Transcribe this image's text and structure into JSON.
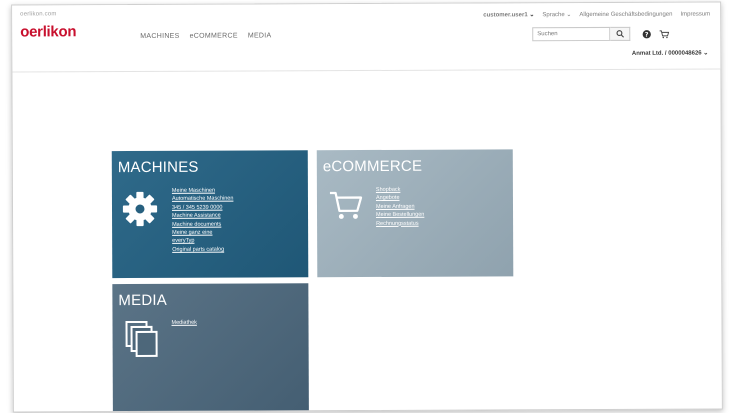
{
  "header": {
    "brand_small": "oerlikon.com",
    "logo": "oerlikon",
    "nav": [
      "MACHINES",
      "eCOMMERCE",
      "MEDIA"
    ],
    "top_links": {
      "user": "customer.user1",
      "language": "Sprache",
      "terms": "Allgemeine Geschäftsbedingungen",
      "imprint": "Impressum"
    },
    "search": {
      "placeholder": "Suchen",
      "value": ""
    },
    "account": "Anmat Ltd. / 0000048626"
  },
  "tiles": {
    "machines": {
      "title": "MACHINES",
      "links": [
        "Meine Maschinen",
        "Automatische Maschinen",
        "345 / 345 5239 0000",
        "Machine Assistance",
        "Machine documents",
        "Meine ganz eine",
        "everyTyp",
        "Original parts catalog"
      ]
    },
    "ecommerce": {
      "title": "eCOMMERCE",
      "links": [
        "Shopback",
        "Angebote",
        "Meine Anfragen",
        "Meine Bestellungen",
        "Rechnungsstatus"
      ]
    },
    "media": {
      "title": "MEDIA",
      "links": [
        "Mediathek"
      ]
    }
  },
  "colors": {
    "brand": "#c8102e",
    "machines_tile": "#2a6585",
    "ecommerce_tile": "#a0b2be",
    "media_tile": "#526b7e"
  },
  "icons": {
    "search": "search-icon",
    "help": "help-icon",
    "cart": "cart-icon",
    "machines": "gear-icon",
    "ecommerce": "shopping-cart-icon",
    "media": "documents-icon"
  }
}
